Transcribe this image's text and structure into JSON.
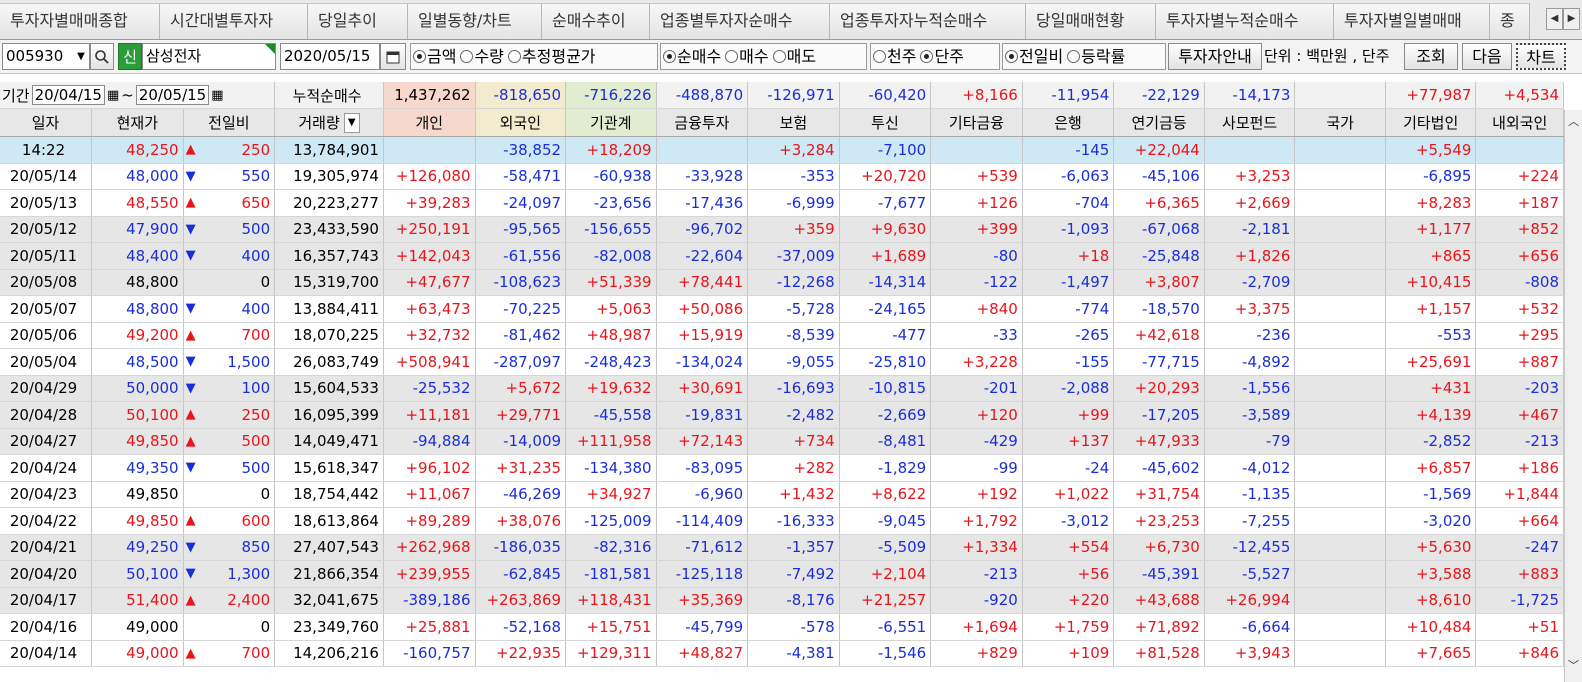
{
  "tabs": [
    {
      "label": "투자자별매매종합"
    },
    {
      "label": "시간대별투자자"
    },
    {
      "label": "당일추이"
    },
    {
      "label": "일별동향/차트"
    },
    {
      "label": "순매수추이"
    },
    {
      "label": "업종별투자자순매수"
    },
    {
      "label": "업종투자자누적순매수"
    },
    {
      "label": "당일매매현황"
    },
    {
      "label": "투자자별누적순매수"
    },
    {
      "label": "투자자별일별매매"
    },
    {
      "label": "종"
    }
  ],
  "controls": {
    "stock_code": "005930",
    "badge": "신",
    "stock_name": "삼성전자",
    "date": "2020/05/15",
    "amount_options": [
      {
        "label": "금액",
        "on": true
      },
      {
        "label": "수량",
        "on": false
      },
      {
        "label": "추정평균가",
        "on": false
      }
    ],
    "trade_options": [
      {
        "label": "순매수",
        "on": true
      },
      {
        "label": "매수",
        "on": false
      },
      {
        "label": "매도",
        "on": false
      }
    ],
    "unit_options": [
      {
        "label": "천주",
        "on": false
      },
      {
        "label": "단주",
        "on": true
      }
    ],
    "compare_options": [
      {
        "label": "전일비",
        "on": true
      },
      {
        "label": "등락률",
        "on": false
      }
    ],
    "guide_button": "투자자안내",
    "unit_text": "단위 : 백만원 , 단주",
    "search_button": "조회",
    "next_button": "다음",
    "chart_button": "차트"
  },
  "period": {
    "label": "기간",
    "from": "20/04/15",
    "sep": "~",
    "to": "20/05/15",
    "cumulative_label": "누적순매수",
    "totals": [
      "1,437,262",
      "-818,650",
      "-716,226",
      "-488,870",
      "-126,971",
      "-60,420",
      "+8,166",
      "-11,954",
      "-22,129",
      "-14,173",
      "",
      "+77,987",
      "+4,534"
    ]
  },
  "columns": [
    "일자",
    "현재가",
    "전일비",
    "거래량",
    "개인",
    "외국인",
    "기관계",
    "금융투자",
    "보험",
    "투신",
    "기타금융",
    "은행",
    "연기금등",
    "사모펀드",
    "국가",
    "기타법인",
    "내외국인"
  ],
  "rows": [
    {
      "date": "14:22",
      "price": "48,250",
      "dir": "up",
      "chg": "250",
      "vol": "13,784,901",
      "v": [
        "",
        "-38,852",
        "+18,209",
        "",
        "+3,284",
        "-7,100",
        "",
        "-145",
        "+22,044",
        "",
        "",
        "+5,549",
        ""
      ]
    },
    {
      "date": "20/05/14",
      "price": "48,000",
      "dir": "down",
      "chg": "550",
      "vol": "19,305,974",
      "v": [
        "+126,080",
        "-58,471",
        "-60,938",
        "-33,928",
        "-353",
        "+20,720",
        "+539",
        "-6,063",
        "-45,106",
        "+3,253",
        "",
        "-6,895",
        "+224"
      ]
    },
    {
      "date": "20/05/13",
      "price": "48,550",
      "dir": "up",
      "chg": "650",
      "vol": "20,223,277",
      "v": [
        "+39,283",
        "-24,097",
        "-23,656",
        "-17,436",
        "-6,999",
        "-7,677",
        "+126",
        "-704",
        "+6,365",
        "+2,669",
        "",
        "+8,283",
        "+187"
      ]
    },
    {
      "date": "20/05/12",
      "price": "47,900",
      "dir": "down",
      "chg": "500",
      "vol": "23,433,590",
      "v": [
        "+250,191",
        "-95,565",
        "-156,655",
        "-96,702",
        "+359",
        "+9,630",
        "+399",
        "-1,093",
        "-67,068",
        "-2,181",
        "",
        "+1,177",
        "+852"
      ]
    },
    {
      "date": "20/05/11",
      "price": "48,400",
      "dir": "down",
      "chg": "400",
      "vol": "16,357,743",
      "v": [
        "+142,043",
        "-61,556",
        "-82,008",
        "-22,604",
        "-37,009",
        "+1,689",
        "-80",
        "+18",
        "-25,848",
        "+1,826",
        "",
        "+865",
        "+656"
      ]
    },
    {
      "date": "20/05/08",
      "price": "48,800",
      "dir": "none",
      "chg": "0",
      "vol": "15,319,700",
      "v": [
        "+47,677",
        "-108,623",
        "+51,339",
        "+78,441",
        "-12,268",
        "-14,314",
        "-122",
        "-1,497",
        "+3,807",
        "-2,709",
        "",
        "+10,415",
        "-808"
      ]
    },
    {
      "date": "20/05/07",
      "price": "48,800",
      "dir": "down",
      "chg": "400",
      "vol": "13,884,411",
      "v": [
        "+63,473",
        "-70,225",
        "+5,063",
        "+50,086",
        "-5,728",
        "-24,165",
        "+840",
        "-774",
        "-18,570",
        "+3,375",
        "",
        "+1,157",
        "+532"
      ]
    },
    {
      "date": "20/05/06",
      "price": "49,200",
      "dir": "up",
      "chg": "700",
      "vol": "18,070,225",
      "v": [
        "+32,732",
        "-81,462",
        "+48,987",
        "+15,919",
        "-8,539",
        "-477",
        "-33",
        "-265",
        "+42,618",
        "-236",
        "",
        "-553",
        "+295"
      ]
    },
    {
      "date": "20/05/04",
      "price": "48,500",
      "dir": "down",
      "chg": "1,500",
      "vol": "26,083,749",
      "v": [
        "+508,941",
        "-287,097",
        "-248,423",
        "-134,024",
        "-9,055",
        "-25,810",
        "+3,228",
        "-155",
        "-77,715",
        "-4,892",
        "",
        "+25,691",
        "+887"
      ]
    },
    {
      "date": "20/04/29",
      "price": "50,000",
      "dir": "down",
      "chg": "100",
      "vol": "15,604,533",
      "v": [
        "-25,532",
        "+5,672",
        "+19,632",
        "+30,691",
        "-16,693",
        "-10,815",
        "-201",
        "-2,088",
        "+20,293",
        "-1,556",
        "",
        "+431",
        "-203"
      ]
    },
    {
      "date": "20/04/28",
      "price": "50,100",
      "dir": "up",
      "chg": "250",
      "vol": "16,095,399",
      "v": [
        "+11,181",
        "+29,771",
        "-45,558",
        "-19,831",
        "-2,482",
        "-2,669",
        "+120",
        "+99",
        "-17,205",
        "-3,589",
        "",
        "+4,139",
        "+467"
      ]
    },
    {
      "date": "20/04/27",
      "price": "49,850",
      "dir": "up",
      "chg": "500",
      "vol": "14,049,471",
      "v": [
        "-94,884",
        "-14,009",
        "+111,958",
        "+72,143",
        "+734",
        "-8,481",
        "-429",
        "+137",
        "+47,933",
        "-79",
        "",
        "-2,852",
        "-213"
      ]
    },
    {
      "date": "20/04/24",
      "price": "49,350",
      "dir": "down",
      "chg": "500",
      "vol": "15,618,347",
      "v": [
        "+96,102",
        "+31,235",
        "-134,380",
        "-83,095",
        "+282",
        "-1,829",
        "-99",
        "-24",
        "-45,602",
        "-4,012",
        "",
        "+6,857",
        "+186"
      ]
    },
    {
      "date": "20/04/23",
      "price": "49,850",
      "dir": "none",
      "chg": "0",
      "vol": "18,754,442",
      "v": [
        "+11,067",
        "-46,269",
        "+34,927",
        "-6,960",
        "+1,432",
        "+8,622",
        "+192",
        "+1,022",
        "+31,754",
        "-1,135",
        "",
        "-1,569",
        "+1,844"
      ]
    },
    {
      "date": "20/04/22",
      "price": "49,850",
      "dir": "up",
      "chg": "600",
      "vol": "18,613,864",
      "v": [
        "+89,289",
        "+38,076",
        "-125,009",
        "-114,409",
        "-16,333",
        "-9,045",
        "+1,792",
        "-3,012",
        "+23,253",
        "-7,255",
        "",
        "-3,020",
        "+664"
      ]
    },
    {
      "date": "20/04/21",
      "price": "49,250",
      "dir": "down",
      "chg": "850",
      "vol": "27,407,543",
      "v": [
        "+262,968",
        "-186,035",
        "-82,316",
        "-71,612",
        "-1,357",
        "-5,509",
        "+1,334",
        "+554",
        "+6,730",
        "-12,455",
        "",
        "+5,630",
        "-247"
      ]
    },
    {
      "date": "20/04/20",
      "price": "50,100",
      "dir": "down",
      "chg": "1,300",
      "vol": "21,866,354",
      "v": [
        "+239,955",
        "-62,845",
        "-181,581",
        "-125,118",
        "-7,492",
        "+2,104",
        "-213",
        "+56",
        "-45,391",
        "-5,527",
        "",
        "+3,588",
        "+883"
      ]
    },
    {
      "date": "20/04/17",
      "price": "51,400",
      "dir": "up",
      "chg": "2,400",
      "vol": "32,041,675",
      "v": [
        "-389,186",
        "+263,869",
        "+118,431",
        "+35,369",
        "-8,176",
        "+21,257",
        "-920",
        "+220",
        "+43,688",
        "+26,994",
        "",
        "+8,610",
        "-1,725"
      ]
    },
    {
      "date": "20/04/16",
      "price": "49,000",
      "dir": "none",
      "chg": "0",
      "vol": "23,349,760",
      "v": [
        "+25,881",
        "-52,168",
        "+15,751",
        "-45,799",
        "-578",
        "-6,551",
        "+1,694",
        "+1,759",
        "+71,892",
        "-6,664",
        "",
        "+10,484",
        "+51"
      ]
    },
    {
      "date": "20/04/14",
      "price": "49,000",
      "dir": "up",
      "chg": "700",
      "vol": "14,206,216",
      "v": [
        "-160,757",
        "+22,935",
        "+129,311",
        "+48,827",
        "-4,381",
        "-1,546",
        "+829",
        "+109",
        "+81,528",
        "+3,943",
        "",
        "+7,665",
        "+846"
      ]
    }
  ],
  "colors": {
    "up": "#e8151a",
    "down": "#1a2ed8",
    "highlight": "#cfe9f4",
    "band": "#e6e6e6"
  }
}
